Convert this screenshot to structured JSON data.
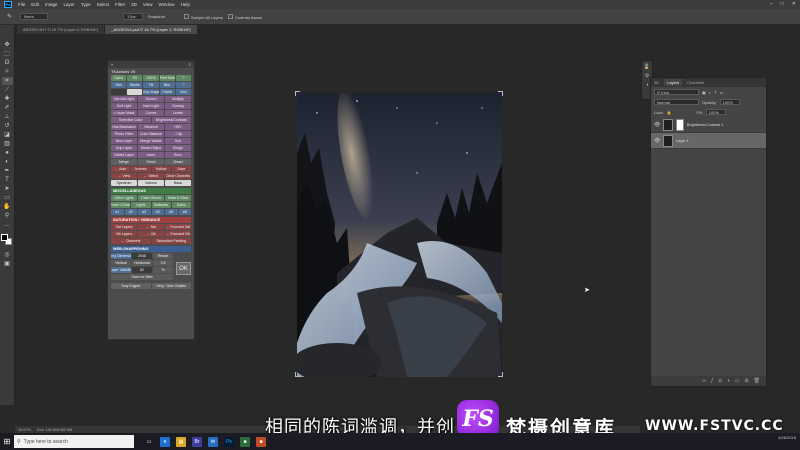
{
  "app": {
    "logo": "Ps",
    "menus": [
      "File",
      "Edit",
      "Image",
      "Layer",
      "Type",
      "Select",
      "Filter",
      "3D",
      "View",
      "Window",
      "Help"
    ]
  },
  "options_bar": {
    "mode_value": "Norm",
    "size_value": "17px",
    "snap_label": "Snapshot",
    "sample_all_label": "Sample All Layers",
    "contrast_label": "Contrast Aware"
  },
  "doc_tabs": [
    {
      "label": "AEGEN-HNT © 16.7% (Layer 0, RGB/16*)",
      "active": false
    },
    {
      "label": "_ADGE014.psd © 16.7% (Layer 1, RGB/16*)",
      "active": true
    }
  ],
  "extension": {
    "title": "TKActions V5",
    "rows": [
      [
        [
          "Open",
          "g"
        ],
        [
          "Fit",
          "g"
        ],
        [
          "100%",
          "g"
        ],
        [
          "Print Size",
          "g"
        ],
        [
          "?",
          "g"
        ]
      ],
      [
        [
          "Stm",
          "b"
        ],
        [
          "Stroke",
          "b"
        ],
        [
          "Fill",
          "b"
        ],
        [
          "Blur",
          "b"
        ],
        [
          "?",
          "b"
        ]
      ],
      [
        [
          "",
          "x"
        ],
        [
          "",
          "l"
        ],
        [
          "Dup Image",
          "b"
        ],
        [
          "Fadeit",
          "b"
        ],
        [
          "Sort",
          "b"
        ]
      ],
      [
        [
          "Normal Light",
          "p"
        ],
        [
          "Screen",
          "p"
        ],
        [
          "Multiply",
          "p"
        ]
      ],
      [
        [
          "Soft Light",
          "p"
        ],
        [
          "Hard Light",
          "p"
        ],
        [
          "Overlay",
          "p"
        ]
      ],
      [
        [
          "< Layer Mask",
          "p"
        ],
        [
          "Curves",
          "p"
        ],
        [
          "Levels",
          "p"
        ]
      ],
      [
        [
          "Selective Color",
          "p"
        ],
        [
          "Brightness/Contrast",
          "p"
        ]
      ],
      [
        [
          "Hue/Saturation",
          "p"
        ],
        [
          "Vibrance",
          "p"
        ],
        [
          "HSV",
          "p"
        ]
      ],
      [
        [
          "Photo Filter",
          "p"
        ],
        [
          "Color Balance",
          "p"
        ],
        [
          "↓ Clip",
          "p"
        ]
      ],
      [
        [
          "New Layer",
          "p"
        ],
        [
          "Merge Visible",
          "p"
        ],
        [
          "Sort",
          "p"
        ]
      ],
      [
        [
          "Dup Layer",
          "p"
        ],
        [
          "Smart Object",
          "p"
        ],
        [
          "Dodge",
          "p"
        ]
      ],
      [
        [
          "Delete Layer",
          "p"
        ],
        [
          "Invert",
          "p"
        ],
        [
          "Burn",
          "p"
        ]
      ],
      [
        [
          "Merge",
          "d"
        ],
        [
          "Finish",
          "d"
        ],
        [
          "Smart",
          "d"
        ]
      ],
      [
        [
          "← Auto",
          "r"
        ],
        [
          "Inverse",
          "r"
        ],
        [
          "Hollow",
          "r"
        ],
        [
          "Save",
          "r"
        ]
      ],
      [
        [
          "← View",
          "r"
        ],
        [
          "← Select",
          "r"
        ],
        [
          "Clear Channels",
          "r"
        ]
      ],
      [
        [
          "Spectrum",
          "l"
        ],
        [
          "Actions",
          "l"
        ],
        [
          "Basic",
          "l"
        ]
      ]
    ],
    "misc_header": "MISCELLANEOUS",
    "misc_rows": [
      [
        [
          "Ortho Lights",
          "g"
        ],
        [
          "Color Gloom",
          "g"
        ],
        [
          "Make it Glow",
          "g"
        ]
      ],
      [
        [
          "Road C-Fade",
          "g"
        ],
        [
          "Lights",
          "g"
        ],
        [
          "Midtones",
          "g"
        ],
        [
          "Darks",
          "g"
        ]
      ],
      [
        [
          "#1",
          "b"
        ],
        [
          "#2",
          "b"
        ],
        [
          "#3",
          "b"
        ],
        [
          "#4",
          "b"
        ],
        [
          "#5",
          "b"
        ],
        [
          "#6",
          "b"
        ]
      ]
    ],
    "sat_header": "SATURATION / VIBRANCE",
    "sat_rows": [
      [
        [
          "Sat Layers",
          "r"
        ],
        [
          "← Sat",
          "r"
        ],
        [
          "← Focused Sat",
          "r"
        ]
      ],
      [
        [
          "Vib Layers",
          "r"
        ],
        [
          "← Vib",
          "r"
        ],
        [
          "← Focused Vib",
          "r"
        ]
      ],
      [
        [
          "← Channels",
          "r"
        ],
        [
          "Saturation Painting",
          "r"
        ]
      ]
    ],
    "web_header": "WEB-SHARPENING",
    "web_rows": [
      [
        [
          "Long Dimension",
          "b"
        ],
        [
          "2048",
          "x"
        ],
        [
          "Resize",
          "s"
        ]
      ],
      [
        [
          "Vertical",
          "s"
        ],
        [
          "Horizontal",
          "s"
        ],
        [
          "0.5",
          "s"
        ]
      ],
      [
        [
          "Layer Visibility",
          "b"
        ],
        [
          "82",
          "x"
        ],
        [
          "%",
          "s"
        ]
      ],
      [
        [
          "Save for Web",
          "s"
        ]
      ]
    ],
    "ok_label": "OK",
    "footer": [
      [
        "Tony Kuyper",
        "d"
      ],
      [
        "Help / User Guides",
        "d"
      ]
    ]
  },
  "layers": {
    "tabs": [
      "3D",
      "Layers",
      "Channels"
    ],
    "kind_label": "Kind",
    "blend_mode": "Normal",
    "opacity_label": "Opacity:",
    "opacity_value": "100%",
    "lock_label": "Lock:",
    "fill_label": "Fill:",
    "fill_value": "100%",
    "items": [
      {
        "name": "Brightness/Contrast 1",
        "selected": false
      },
      {
        "name": "Layer 1",
        "selected": true
      }
    ]
  },
  "status_bar": {
    "zoom": "16.67%",
    "doc": "Doc: 182.8M/382.9M"
  },
  "overlay": {
    "subtitle": "相同的陈词滥调，并创",
    "wm_logo": "FS",
    "wm_text": "梵摄创意库",
    "wm_url": "WWW.FSTVC.CC"
  },
  "taskbar": {
    "search_placeholder": "Type here to search",
    "tray_date": "4/26/2018"
  },
  "colors": {
    "ps_bg": "#282828",
    "panel_bg": "#454545",
    "accent_ps": "#31a8ff",
    "watermark_purple": "#9b2bd9"
  }
}
